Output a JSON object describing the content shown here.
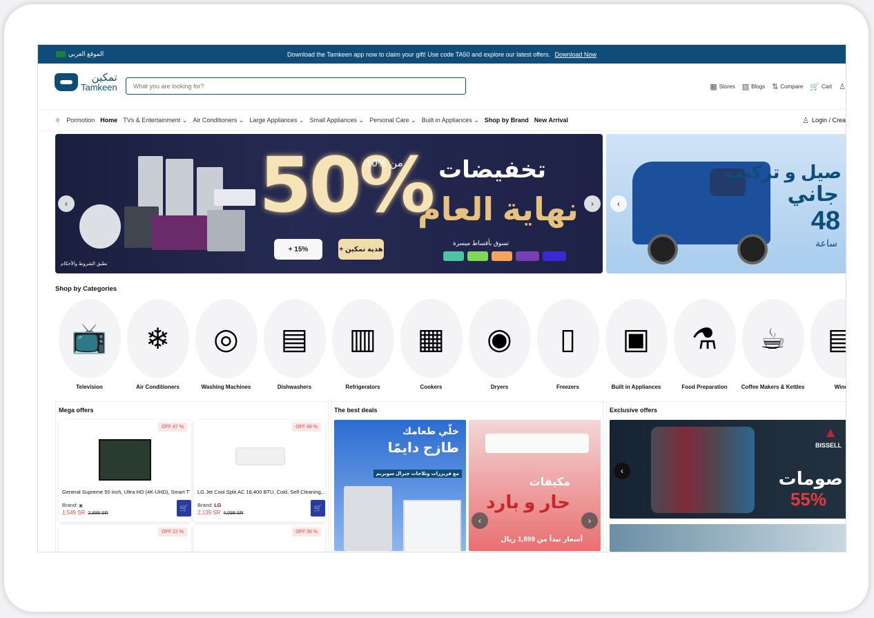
{
  "topbar": {
    "lang_label": "الموقع العربي",
    "promo_text": "Download the Tamkeen app now to claim your gift! Use code TA50 and explore our latest offers.",
    "promo_link": "Download Now"
  },
  "header": {
    "logo_ar": "تمكين",
    "logo_en": "Tamkeen",
    "search_placeholder": "What you are looking for?",
    "tools": [
      {
        "label": "Stores",
        "icon": "store-icon"
      },
      {
        "label": "Blogs",
        "icon": "blog-icon"
      },
      {
        "label": "Compare",
        "icon": "compare-icon"
      },
      {
        "label": "Cart",
        "icon": "cart-icon"
      }
    ]
  },
  "nav": {
    "items": [
      {
        "label": "Pormotion",
        "style": "normal"
      },
      {
        "label": "Home",
        "style": "active"
      },
      {
        "label": "TVs & Entertainment ⌄",
        "style": "normal"
      },
      {
        "label": "Air Conditioners ⌄",
        "style": "normal"
      },
      {
        "label": "Large Appliances ⌄",
        "style": "normal"
      },
      {
        "label": "Small Appliances ⌄",
        "style": "normal"
      },
      {
        "label": "Personal Care ⌄",
        "style": "normal"
      },
      {
        "label": "Built in Appliances ⌄",
        "style": "normal"
      },
      {
        "label": "Shop by Brand",
        "style": "bold"
      },
      {
        "label": "New Arrival",
        "style": "bold"
      }
    ],
    "login_label": "Login / Crea"
  },
  "hero": {
    "big_text": "50%",
    "pct_text": "10% من",
    "ar_title": "تخفيضات",
    "ar_title2": "نهاية العام",
    "installments": "تسوق بأقساط ميسرة",
    "terms": "تطبق الشروط والأحكام",
    "badge1": "+ هدية تمكين",
    "badge2": "+ 15%"
  },
  "hero_side": {
    "line1": "صيل و تركيب",
    "line2": "جاني",
    "line3": "48",
    "line4": "ساعة"
  },
  "categories": {
    "title": "Shop by Categories",
    "items": [
      {
        "label": "Television",
        "glyph": "📺"
      },
      {
        "label": "Air Conditioners",
        "glyph": "❄"
      },
      {
        "label": "Washing Machines",
        "glyph": "◎"
      },
      {
        "label": "Dishwashers",
        "glyph": "▤"
      },
      {
        "label": "Refrigerators",
        "glyph": "▥"
      },
      {
        "label": "Cookers",
        "glyph": "▦"
      },
      {
        "label": "Dryers",
        "glyph": "◉"
      },
      {
        "label": "Freezers",
        "glyph": "▯"
      },
      {
        "label": "Built in Appliances",
        "glyph": "▣"
      },
      {
        "label": "Food Preparation",
        "glyph": "⚗"
      },
      {
        "label": "Coffee Makers & Kettles",
        "glyph": "☕"
      },
      {
        "label": "Wind",
        "glyph": "▤"
      }
    ]
  },
  "mega": {
    "title": "Mega offers",
    "products": [
      {
        "off": "OFF 47 %",
        "name": "General Supreme 50 inch, Ultra HD (4K-UHD), Smart TV,...",
        "brand": "Brand:",
        "price": "1,549 SR",
        "old": "2,899 SR"
      },
      {
        "off": "OFF 48 %",
        "name": "LG Jet Cool Split AC 18,400 BTU, Cold, Self Cleaning,...",
        "brand": "Brand:",
        "brand_name": "LG",
        "price": "2,139 SR",
        "old": "4,099 SR"
      }
    ],
    "off3": "OFF 22 %",
    "off4": "OFF 30 %"
  },
  "deals": {
    "title": "The best deals",
    "card1_line1": "خلّي طعامك",
    "card1_line2": "طازج دايمًا",
    "card1_line3": "مع فريزرات وثلاجات جنرال سوبريم",
    "card2_line1": "مكيفات",
    "card2_line2": "حار و بارد",
    "card2_line3": "أسعار تبدأ من 1,899 ريال"
  },
  "exclusive": {
    "title": "Exclusive offers",
    "brand": "BISSELL",
    "line1": "صومات",
    "line2": "55%"
  }
}
